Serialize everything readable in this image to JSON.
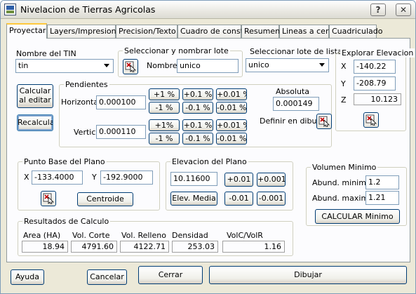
{
  "window": {
    "title": "Nivelacion de Tierras Agricolas",
    "help_glyph": "?",
    "close_glyph": "✕"
  },
  "tabs": [
    {
      "label": "Proyectar"
    },
    {
      "label": "Layers/Impresion"
    },
    {
      "label": "Precision/Texto"
    },
    {
      "label": "Cuadro de constr."
    },
    {
      "label": "Resumen"
    },
    {
      "label": "Lineas a cero"
    },
    {
      "label": "Cuadriculado"
    }
  ],
  "tin": {
    "label": "Nombre del TIN",
    "value": "tin"
  },
  "lote": {
    "group_label": "Seleccionar y nombrar lote",
    "name_label": "Nombre",
    "name_value": "unico"
  },
  "lote_lista": {
    "label": "Seleccionar lote de lista",
    "value": "unico"
  },
  "explorar": {
    "group_label": "Explorar Elevacion",
    "x_label": "X",
    "x_value": "-140.22",
    "y_label": "Y",
    "y_value": "-208.79",
    "z_label": "Z",
    "z_value": "10.123"
  },
  "buttons_left": {
    "calcular": "Calcular\nal editar",
    "recalcula": "Recalcula"
  },
  "pendientes": {
    "group_label": "Pendientes",
    "horizontal_label": "Horizontal",
    "horizontal_value": "0.000100",
    "vertical_label": "Vertical",
    "vertical_value": "0.000110",
    "h_up": [
      "+1 %",
      "+0.1 %",
      "+0.01 %"
    ],
    "h_down": [
      "-1 %",
      "-0.1 %",
      "-0.01 %"
    ],
    "v_up": [
      "+1%",
      "+0.1 %",
      "+0.01 %"
    ],
    "v_down": [
      "-1 %",
      "-0.1 %",
      "-0.01 %"
    ],
    "absoluta_label": "Absoluta",
    "absoluta_value": "0.000149",
    "definir_label": "Definir en dibujo"
  },
  "punto_base": {
    "group_label": "Punto Base del Plano",
    "x_label": "X",
    "x_value": "-133.4000",
    "y_label": "Y",
    "y_value": "-192.9000",
    "centroide": "Centroide"
  },
  "elevacion_plano": {
    "group_label": "Elevacion del Plano",
    "value": "10.11600",
    "elev_media": "Elev. Media",
    "p1": "+0.01",
    "p2": "+0.001",
    "m1": "-0.01",
    "m2": "-0.001"
  },
  "volumen": {
    "group_label": "Volumen Minimo",
    "min_label": "Abund. minimo",
    "min_value": "1.2",
    "max_label": "Abund. maximo",
    "max_value": "1.21",
    "calc": "CALCULAR Minimo"
  },
  "resultados": {
    "group_label": "Resultados de Calculo",
    "headers": [
      "Area (HA)",
      "Vol. Corte",
      "Vol. Relleno",
      "Densidad",
      "VolC/VolR"
    ],
    "values": [
      "18.94",
      "4791.60",
      "4122.71",
      "253.03",
      "1.16"
    ]
  },
  "footer": {
    "ayuda": "Ayuda",
    "cancelar": "Cancelar",
    "cerrar": "Cerrar",
    "dibujar": "Dibujar"
  }
}
